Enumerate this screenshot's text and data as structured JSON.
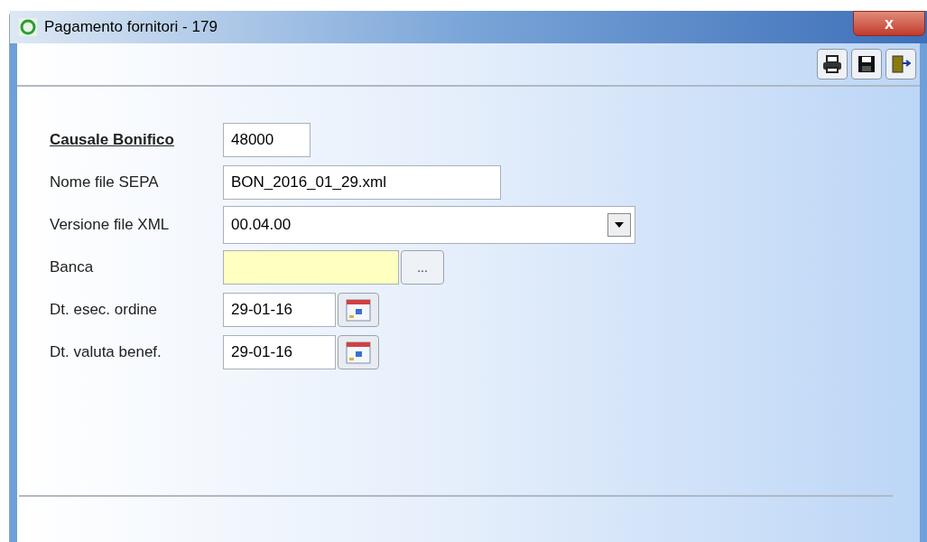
{
  "window": {
    "title": "Pagamento fornitori - 179",
    "close": "x"
  },
  "form": [
    {
      "kind": "text",
      "label": "Causale Bonifico",
      "required": true,
      "value": "48000"
    },
    {
      "kind": "text",
      "label": "Nome file SEPA",
      "required": false,
      "value": "BON_2016_01_29.xml"
    },
    {
      "kind": "combo",
      "label": "Versione file XML",
      "required": false,
      "value": "00.04.00"
    },
    {
      "kind": "lookup",
      "label": "Banca",
      "required": false,
      "button": "..."
    },
    {
      "kind": "date",
      "label": "Dt. esec. ordine",
      "required": false,
      "value": "29-01-16"
    },
    {
      "kind": "date",
      "label": "Dt. valuta benef.",
      "required": false,
      "value": "29-01-16"
    }
  ]
}
